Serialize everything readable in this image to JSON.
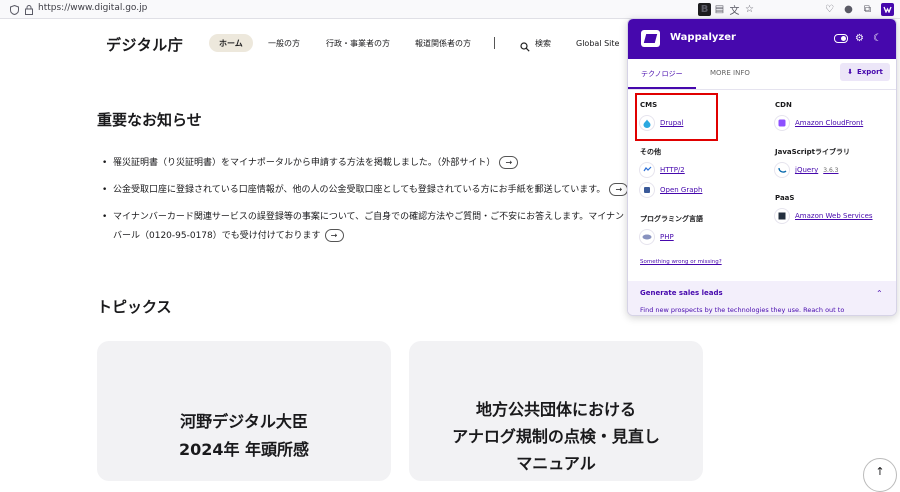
{
  "browser": {
    "url": "https://www.digital.go.jp",
    "icons": [
      "shield-icon",
      "lock-icon",
      "reader-mode-icon",
      "bookmark-star-icon",
      "pocket-icon",
      "account-icon",
      "extensions-icon",
      "wappalyzer-extension-icon"
    ]
  },
  "site": {
    "logo": "デジタル庁",
    "nav": [
      {
        "label": "ホーム",
        "active": true
      },
      {
        "label": "一般の方"
      },
      {
        "label": "行政・事業者の方"
      },
      {
        "label": "報道関係者の方"
      },
      {
        "label": "検索"
      },
      {
        "label": "Global Site"
      }
    ],
    "important_heading": "重要なお知らせ",
    "news": [
      "罹災証明書（り災証明書）をマイナポータルから申請する方法を掲載しました。（外部サイト）",
      "公金受取口座に登録されている口座情報が、他の人の公金受取口座としても登録されている方にお手紙を郵送しています。",
      "マイナンバーカード関連サービスの誤登録等の事案について、ご自身での確認方法やご質問・ご不安にお答えします。マイナンバール（0120-95-0178）でも受け付けております"
    ],
    "topics_heading": "トピックス",
    "cards": [
      {
        "line1": "河野デジタル大臣",
        "line2": "2024年 年頭所感"
      },
      {
        "line1": "地方公共団体における",
        "line2": "アナログ規制の点検・見直し",
        "line3": "マニュアル"
      }
    ]
  },
  "wappalyzer": {
    "title": "Wappalyzer",
    "tabs": [
      "テクノロジー",
      "MORE INFO"
    ],
    "export_label": "Export",
    "categories": {
      "cms": {
        "label": "CMS",
        "items": [
          {
            "name": "Drupal"
          }
        ]
      },
      "other": {
        "label": "その他",
        "items": [
          {
            "name": "HTTP/2"
          },
          {
            "name": "Open Graph"
          }
        ]
      },
      "lang": {
        "label": "プログラミング言語",
        "items": [
          {
            "name": "PHP"
          }
        ]
      },
      "cdn": {
        "label": "CDN",
        "items": [
          {
            "name": "Amazon CloudFront"
          }
        ]
      },
      "js": {
        "label": "JavaScriptライブラリ",
        "items": [
          {
            "name": "jQuery",
            "version": "3.6.3"
          }
        ]
      },
      "paas": {
        "label": "PaaS",
        "items": [
          {
            "name": "Amazon Web Services"
          }
        ]
      }
    },
    "something_wrong": "Something wrong or missing?",
    "leads_title": "Generate sales leads",
    "leads_text": "Find new prospects by the technologies they use. Reach out to"
  },
  "colors": {
    "wappalyzer_purple": "#4608ad",
    "highlight_red": "#e00000",
    "nav_active_bg": "#ede8dc"
  }
}
